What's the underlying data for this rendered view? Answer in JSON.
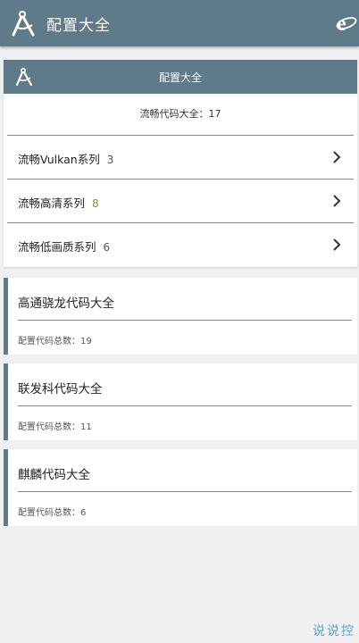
{
  "app": {
    "title": "配置大全",
    "accent": "#5f7b8a"
  },
  "card": {
    "header_title": "配置大全",
    "summary_label": "流畅代码大全：",
    "summary_count": "17",
    "rows": [
      {
        "label": "流畅Vulkan系列",
        "count": "3"
      },
      {
        "label": "流畅高清系列",
        "count": "8"
      },
      {
        "label": "流畅低画质系列",
        "count": "6"
      }
    ]
  },
  "vendors": [
    {
      "name": "高通骁龙代码大全",
      "total_label": "配置代码总数：",
      "total": "19"
    },
    {
      "name": "联发科代码大全",
      "total_label": "配置代码总数：",
      "total": "11"
    },
    {
      "name": "麒麟代码大全",
      "total_label": "配置代码总数：",
      "total": "6"
    }
  ],
  "watermark": "说说控"
}
